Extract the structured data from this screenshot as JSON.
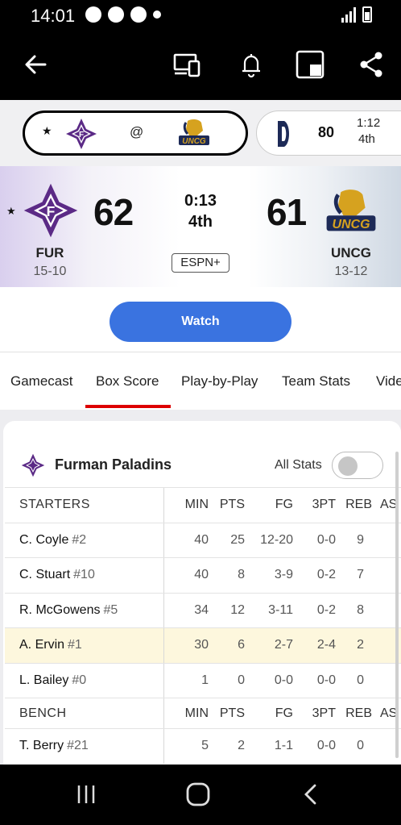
{
  "status_bar": {
    "time": "14:01"
  },
  "game_strip": {
    "active": {
      "at": "@",
      "away_logo": "F",
      "home_logo_text": "UNCG"
    },
    "other": {
      "team_logo": "D",
      "score": "80",
      "clock": "1:12",
      "period": "4th"
    }
  },
  "scoreboard": {
    "away": {
      "abbr": "FUR",
      "record": "15-10",
      "score": "62",
      "logo": "F"
    },
    "home": {
      "abbr": "UNCG",
      "record": "13-12",
      "score": "61",
      "logo_text": "UNCG"
    },
    "clock": "0:13",
    "period": "4th",
    "network": "ESPN+",
    "watch_label": "Watch"
  },
  "tabs": [
    "Gamecast",
    "Box Score",
    "Play-by-Play",
    "Team Stats",
    "Vide"
  ],
  "box_score": {
    "team_name": "Furman Paladins",
    "all_stats_label": "All Stats",
    "columns": [
      "MIN",
      "PTS",
      "FG",
      "3PT",
      "REB",
      "AS"
    ],
    "starters_label": "STARTERS",
    "bench_label": "BENCH",
    "starters": [
      {
        "name": "C. Coyle",
        "num": "#2",
        "min": "40",
        "pts": "25",
        "fg": "12-20",
        "tpt": "0-0",
        "reb": "9"
      },
      {
        "name": "C. Stuart",
        "num": "#10",
        "min": "40",
        "pts": "8",
        "fg": "3-9",
        "tpt": "0-2",
        "reb": "7"
      },
      {
        "name": "R. McGowens",
        "num": "#5",
        "min": "34",
        "pts": "12",
        "fg": "3-11",
        "tpt": "0-2",
        "reb": "8"
      },
      {
        "name": "A. Ervin",
        "num": "#1",
        "min": "30",
        "pts": "6",
        "fg": "2-7",
        "tpt": "2-4",
        "reb": "2"
      },
      {
        "name": "L. Bailey",
        "num": "#0",
        "min": "1",
        "pts": "0",
        "fg": "0-0",
        "tpt": "0-0",
        "reb": "0"
      }
    ],
    "bench": [
      {
        "name": "T. Berry",
        "num": "#21",
        "min": "5",
        "pts": "2",
        "fg": "1-1",
        "tpt": "0-0",
        "reb": "0"
      }
    ]
  },
  "colors": {
    "accent": "#d00000",
    "watch": "#3a73e0",
    "furman_purple": "#5b2a86",
    "uncg_gold": "#d6a21f"
  }
}
